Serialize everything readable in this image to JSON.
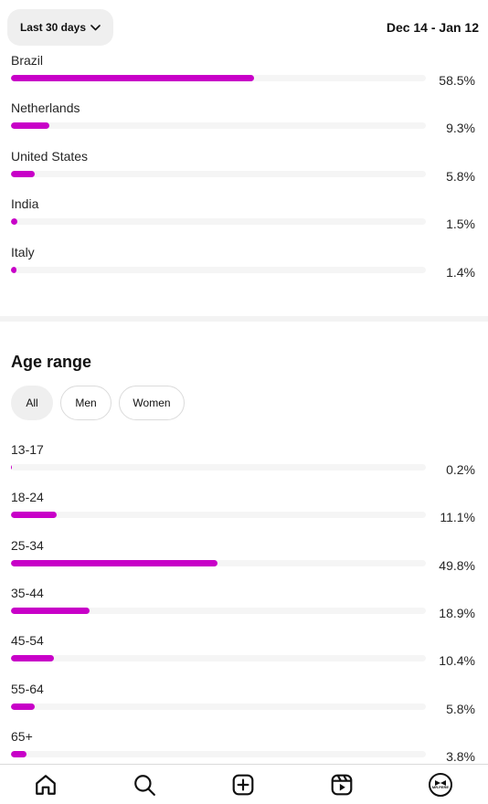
{
  "header": {
    "range_label": "Last 30 days",
    "date_range": "Dec 14 - Jan 12"
  },
  "countries": [
    {
      "name": "Brazil",
      "percent": "58.5%",
      "value": 58.5
    },
    {
      "name": "Netherlands",
      "percent": "9.3%",
      "value": 9.3
    },
    {
      "name": "United States",
      "percent": "5.8%",
      "value": 5.8
    },
    {
      "name": "India",
      "percent": "1.5%",
      "value": 1.5
    },
    {
      "name": "Italy",
      "percent": "1.4%",
      "value": 1.4
    }
  ],
  "age_section": {
    "title": "Age range",
    "filters": [
      "All",
      "Men",
      "Women"
    ],
    "active_filter": "All",
    "groups": [
      {
        "range": "13-17",
        "percent": "0.2%",
        "value": 0.2
      },
      {
        "range": "18-24",
        "percent": "11.1%",
        "value": 11.1
      },
      {
        "range": "25-34",
        "percent": "49.8%",
        "value": 49.8
      },
      {
        "range": "35-44",
        "percent": "18.9%",
        "value": 18.9
      },
      {
        "range": "45-54",
        "percent": "10.4%",
        "value": 10.4
      },
      {
        "range": "55-64",
        "percent": "5.8%",
        "value": 5.8
      },
      {
        "range": "65+",
        "percent": "3.8%",
        "value": 3.8
      }
    ]
  },
  "bottom_nav": [
    "home-icon",
    "search-icon",
    "create-icon",
    "reels-icon",
    "profile-avatar"
  ],
  "avatar_text": "MR.PERE",
  "colors": {
    "bar": "#c800c8",
    "track": "#f5f5f5"
  }
}
